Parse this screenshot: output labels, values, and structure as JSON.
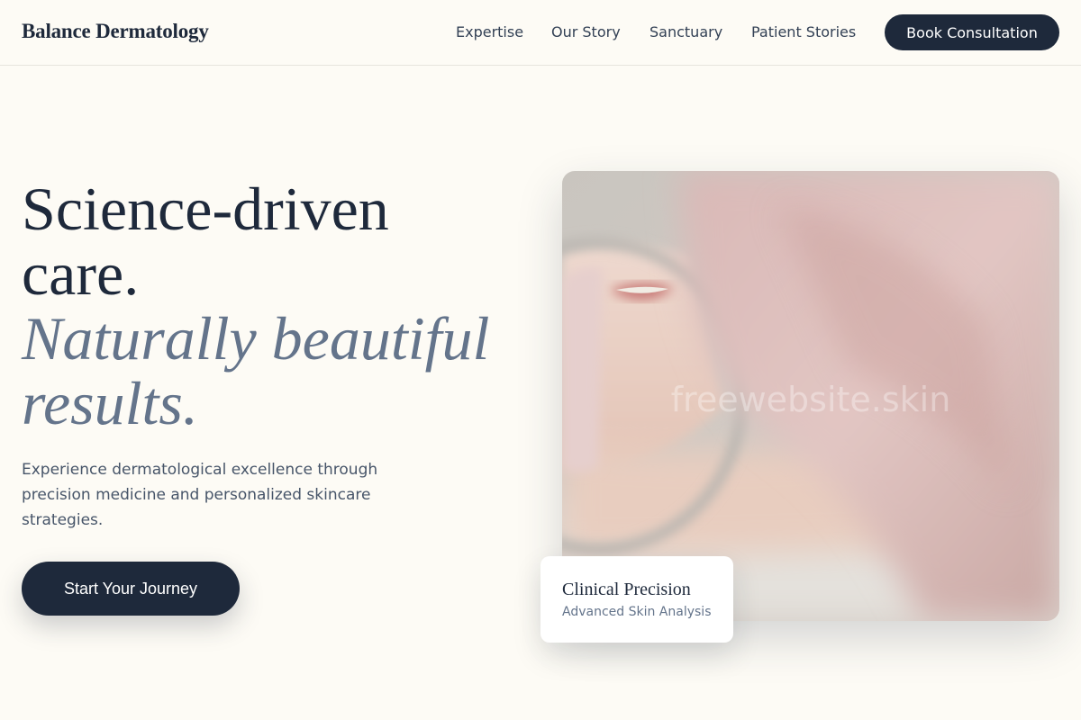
{
  "header": {
    "brand": "Balance Dermatology",
    "nav": [
      "Expertise",
      "Our Story",
      "Sanctuary",
      "Patient Stories"
    ],
    "cta_label": "Book Consultation"
  },
  "hero": {
    "title_lines": [
      "Science-driven",
      "care."
    ],
    "italic_lines": [
      "Naturally beautiful",
      "results."
    ],
    "description": "Experience dermatological excellence through precision medicine and personalized skincare strategies.",
    "cta_label": "Start Your Journey",
    "watermark": "freewebsite.skin"
  },
  "feature_card": {
    "title": "Clinical Precision",
    "subtitle": "Advanced Skin Analysis"
  },
  "colors": {
    "background": "#fdfbf5",
    "primary": "#1e293b",
    "muted": "#64748b",
    "accent_pink": "#e8c8c8"
  }
}
